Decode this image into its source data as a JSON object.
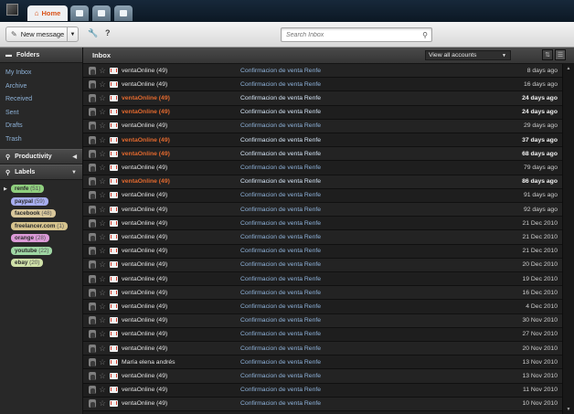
{
  "top_tabs": [
    {
      "label": "Home",
      "icon": "home-icon"
    },
    {
      "icon": "contacts-icon"
    },
    {
      "icon": "documents-icon"
    },
    {
      "icon": "apps-icon"
    }
  ],
  "toolbar": {
    "new_message_label": "New message",
    "search_placeholder": "Search Inbox"
  },
  "sidebar": {
    "folders_title": "Folders",
    "folders": [
      "My Inbox",
      "Archive",
      "Received",
      "Sent",
      "Drafts",
      "Trash"
    ],
    "productivity_title": "Productivity",
    "labels_title": "Labels",
    "labels": [
      {
        "name": "renfe",
        "count": "(51)",
        "color": "#8fcf7e"
      },
      {
        "name": "paypal",
        "count": "(59)",
        "color": "#a7aef0"
      },
      {
        "name": "facebook",
        "count": "(48)",
        "color": "#d9c79b"
      },
      {
        "name": "freelancer.com",
        "count": "(1)",
        "color": "#d7c48e"
      },
      {
        "name": "orange",
        "count": "(28)",
        "color": "#dc9ad8"
      },
      {
        "name": "youtube",
        "count": "(22)",
        "color": "#9fd7a4"
      },
      {
        "name": "ebay",
        "count": "(20)",
        "color": "#cfe0a8"
      }
    ]
  },
  "inbox": {
    "title": "Inbox",
    "accounts_selected": "View all accounts",
    "messages": [
      {
        "sender": "ventaOnline (49)",
        "subject": "Confirmacion de venta Renfe",
        "date": "8 days ago",
        "unread": false
      },
      {
        "sender": "ventaOnline (49)",
        "subject": "Confirmacion de venta Renfe",
        "date": "16 days ago",
        "unread": false
      },
      {
        "sender": "ventaOnline (49)",
        "subject": "Confirmacion de venta Renfe",
        "date": "24 days ago",
        "unread": true
      },
      {
        "sender": "ventaOnline (49)",
        "subject": "Confirmacion de venta Renfe",
        "date": "24 days ago",
        "unread": true
      },
      {
        "sender": "ventaOnline (49)",
        "subject": "Confirmacion de venta Renfe",
        "date": "29 days ago",
        "unread": false
      },
      {
        "sender": "ventaOnline (49)",
        "subject": "Confirmacion de venta Renfe",
        "date": "37 days ago",
        "unread": true
      },
      {
        "sender": "ventaOnline (49)",
        "subject": "Confirmacion de venta Renfe",
        "date": "68 days ago",
        "unread": true
      },
      {
        "sender": "ventaOnline (49)",
        "subject": "Confirmacion de venta Renfe",
        "date": "79 days ago",
        "unread": false
      },
      {
        "sender": "ventaOnline (49)",
        "subject": "Confirmacion de venta Renfe",
        "date": "86 days ago",
        "unread": true
      },
      {
        "sender": "ventaOnline (49)",
        "subject": "Confirmacion de venta Renfe",
        "date": "91 days ago",
        "unread": false
      },
      {
        "sender": "ventaOnline (49)",
        "subject": "Confirmacion de venta Renfe",
        "date": "92 days ago",
        "unread": false
      },
      {
        "sender": "ventaOnline (49)",
        "subject": "Confirmacion de venta Renfe",
        "date": "21 Dec 2010",
        "unread": false
      },
      {
        "sender": "ventaOnline (49)",
        "subject": "Confirmacion de venta Renfe",
        "date": "21 Dec 2010",
        "unread": false
      },
      {
        "sender": "ventaOnline (49)",
        "subject": "Confirmacion de venta Renfe",
        "date": "21 Dec 2010",
        "unread": false
      },
      {
        "sender": "ventaOnline (49)",
        "subject": "Confirmacion de venta Renfe",
        "date": "20 Dec 2010",
        "unread": false
      },
      {
        "sender": "ventaOnline (49)",
        "subject": "Confirmacion de venta Renfe",
        "date": "19 Dec 2010",
        "unread": false
      },
      {
        "sender": "ventaOnline (49)",
        "subject": "Confirmacion de venta Renfe",
        "date": "16 Dec 2010",
        "unread": false
      },
      {
        "sender": "ventaOnline (49)",
        "subject": "Confirmacion de venta Renfe",
        "date": "4 Dec 2010",
        "unread": false
      },
      {
        "sender": "ventaOnline (49)",
        "subject": "Confirmacion de venta Renfe",
        "date": "30 Nov 2010",
        "unread": false
      },
      {
        "sender": "ventaOnline (49)",
        "subject": "Confirmacion de venta Renfe",
        "date": "27 Nov 2010",
        "unread": false
      },
      {
        "sender": "ventaOnline (49)",
        "subject": "Confirmacion de venta Renfe",
        "date": "20 Nov 2010",
        "unread": false
      },
      {
        "sender": "María elena andrés",
        "subject": "Confirmacion de venta Renfe",
        "date": "13 Nov 2010",
        "unread": false
      },
      {
        "sender": "ventaOnline (49)",
        "subject": "Confirmacion de venta Renfe",
        "date": "13 Nov 2010",
        "unread": false
      },
      {
        "sender": "ventaOnline (49)",
        "subject": "Confirmacion de venta Renfe",
        "date": "11 Nov 2010",
        "unread": false
      },
      {
        "sender": "ventaOnline (49)",
        "subject": "Confirmacion de venta Renfe",
        "date": "10 Nov 2010",
        "unread": false
      }
    ]
  }
}
